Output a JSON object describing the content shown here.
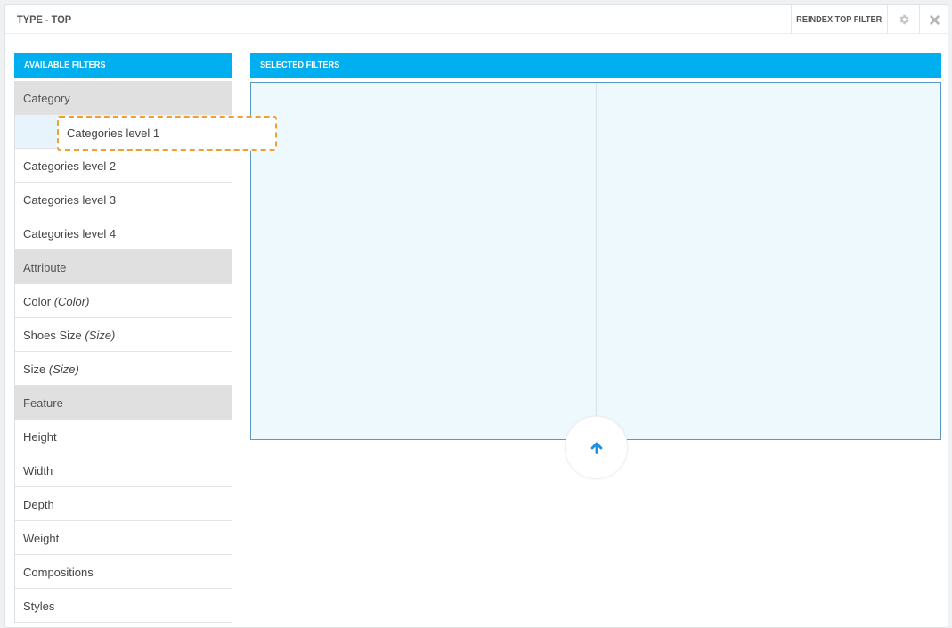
{
  "header": {
    "title": "TYPE - TOP",
    "reindex_label": "REINDEX TOP FILTER",
    "gear_icon": "gear-icon",
    "close_icon": "close-icon"
  },
  "available": {
    "heading": "AVAILABLE FILTERS",
    "dragging_item": "Categories level 1",
    "rows": [
      {
        "label": "Category",
        "sub": "",
        "group": true
      },
      {
        "label": "",
        "sub": "",
        "placeholder": true
      },
      {
        "label": "Categories level 2",
        "sub": ""
      },
      {
        "label": "Categories level 3",
        "sub": ""
      },
      {
        "label": "Categories level 4",
        "sub": ""
      },
      {
        "label": "Attribute",
        "sub": "",
        "group": true
      },
      {
        "label": "Color",
        "sub": "(Color)"
      },
      {
        "label": "Shoes Size",
        "sub": "(Size)"
      },
      {
        "label": "Size",
        "sub": "(Size)"
      },
      {
        "label": "Feature",
        "sub": "",
        "group": true
      },
      {
        "label": "Height",
        "sub": ""
      },
      {
        "label": "Width",
        "sub": ""
      },
      {
        "label": "Depth",
        "sub": ""
      },
      {
        "label": "Weight",
        "sub": ""
      },
      {
        "label": "Compositions",
        "sub": ""
      },
      {
        "label": "Styles",
        "sub": ""
      }
    ]
  },
  "selected": {
    "heading": "SELECTED FILTERS",
    "up_icon": "arrow-up-icon"
  },
  "colors": {
    "accent": "#00aff0",
    "arrow": "#1e90e0",
    "drag_border": "#f0a030"
  }
}
